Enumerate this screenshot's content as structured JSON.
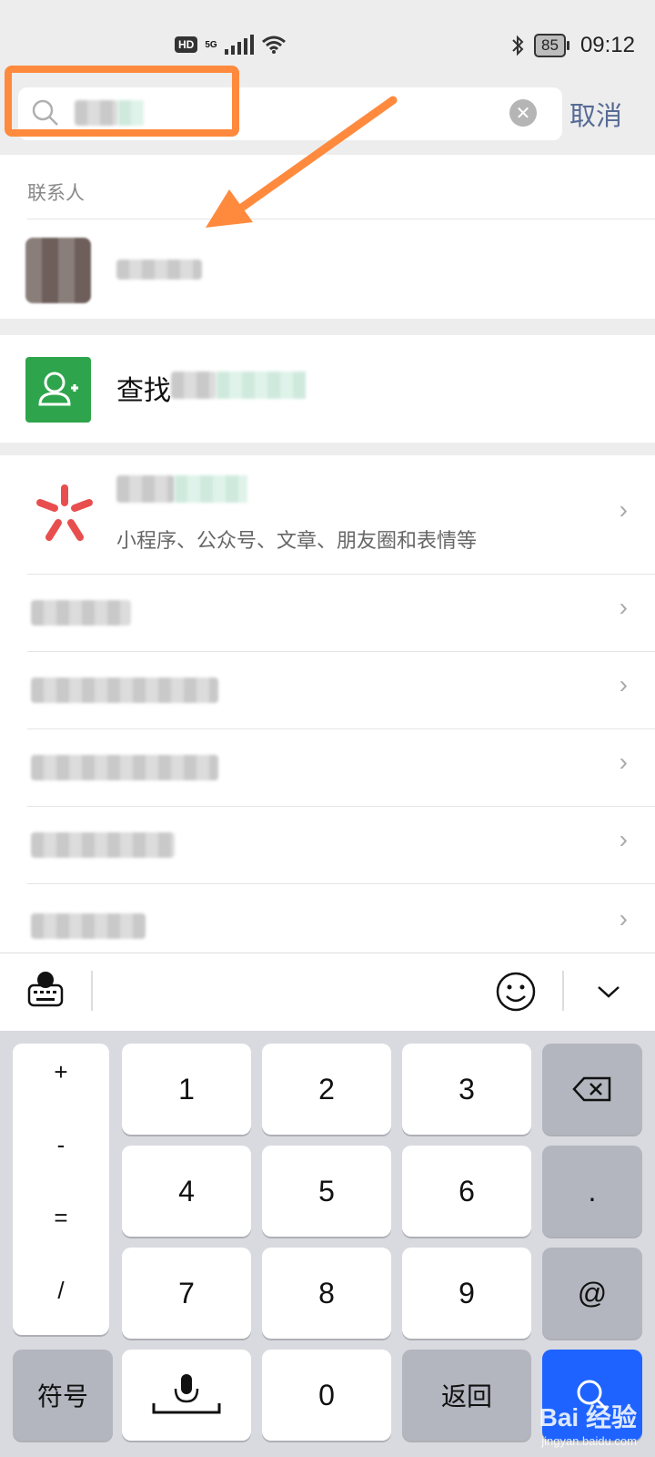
{
  "status_bar": {
    "hd": "HD",
    "network": "5G",
    "battery": "85",
    "time": "09:12"
  },
  "search": {
    "cancel_label": "取消"
  },
  "contacts": {
    "section_title": "联系人"
  },
  "find_row": {
    "label_prefix": "查找"
  },
  "search_feature": {
    "subtitle": "小程序、公众号、文章、朋友圈和表情等"
  },
  "keyboard": {
    "row_keys": [
      [
        "1",
        "2",
        "3"
      ],
      [
        "4",
        "5",
        "6"
      ],
      [
        "7",
        "8",
        "9"
      ]
    ],
    "side_symbols": [
      "+",
      "-",
      "=",
      "/"
    ],
    "right_keys": [
      ".",
      "@"
    ],
    "symbol_key": "符号",
    "zero_key": "0",
    "back_key": "返回"
  },
  "watermark": {
    "brand": "Bai 经验",
    "url": "jingyan.baidu.com"
  },
  "colors": {
    "highlight": "#ff8a3d",
    "link_blue": "#576b95",
    "add_friend_green": "#2ea54c",
    "search_logo_red": "#e94e4e",
    "search_key_blue": "#1e63ff"
  }
}
